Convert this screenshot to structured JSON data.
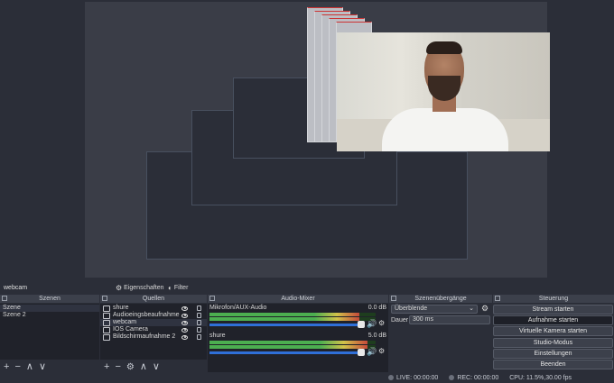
{
  "source_label": "webcam",
  "toolbar": {
    "properties": "Eigenschaften",
    "filter": "Filter"
  },
  "docks": {
    "scenes": "Szenen",
    "sources": "Quellen",
    "mixer": "Audio-Mixer",
    "transitions": "Szenenübergänge",
    "controls": "Steuerung"
  },
  "scenes": [
    "Szene",
    "Szene 2"
  ],
  "sources": [
    {
      "name": "shure",
      "icon": "microphone-icon"
    },
    {
      "name": "Audioeingsbeaufnahme",
      "icon": "microphone-icon"
    },
    {
      "name": "webcam",
      "icon": "camera-icon"
    },
    {
      "name": "IOS Camera",
      "icon": "camera-icon"
    },
    {
      "name": "Bildschirmaufnahme 2",
      "icon": "monitor-icon"
    }
  ],
  "mixer": [
    {
      "name": "Mikrofon/AUX-Audio",
      "db": "0.0 dB",
      "level": 0.9
    },
    {
      "name": "shure",
      "db": "5.0 dB",
      "level": 0.95
    }
  ],
  "transition": {
    "selected": "Überblende",
    "duration_label": "Dauer",
    "duration": "300 ms"
  },
  "controls": [
    "Stream starten",
    "Aufnahme starten",
    "Virtuelle Kamera starten",
    "Studio-Modus",
    "Einstellungen",
    "Beenden"
  ],
  "status": {
    "live": "LIVE: 00:00:00",
    "rec": "REC: 00:00:00",
    "cpu": "CPU: 11.5%,30.00 fps"
  },
  "colors": {
    "bg": "#2b2e38",
    "panel": "#20222a",
    "accent": "#2f6fd8",
    "meter_green": "#4caf50"
  }
}
